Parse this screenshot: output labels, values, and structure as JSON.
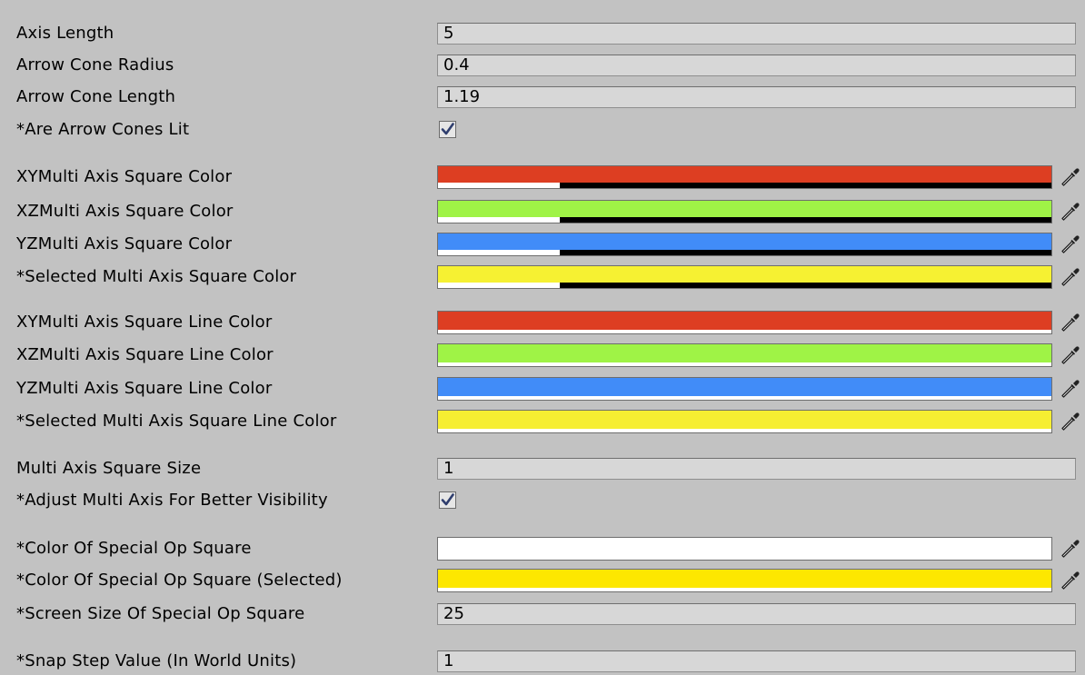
{
  "inspector": {
    "axis_length": {
      "label": "Axis Length",
      "value": "5"
    },
    "arrow_cone_radius": {
      "label": "Arrow Cone Radius",
      "value": "0.4"
    },
    "arrow_cone_length": {
      "label": "Arrow Cone Length",
      "value": "1.19"
    },
    "are_arrow_cones_lit": {
      "label": "*Are Arrow Cones Lit",
      "checked": true
    },
    "xy_square_color": {
      "label": "XYMulti Axis Square Color",
      "color": "#dd3e22"
    },
    "xz_square_color": {
      "label": "XZMulti Axis Square Color",
      "color": "#9ff346"
    },
    "yz_square_color": {
      "label": "YZMulti Axis Square Color",
      "color": "#418cf8"
    },
    "selected_square_color": {
      "label": "*Selected Multi Axis Square Color",
      "color": "#f6f132"
    },
    "xy_line_color": {
      "label": "XYMulti Axis Square Line Color",
      "color": "#dd3e22"
    },
    "xz_line_color": {
      "label": "XZMulti Axis Square Line Color",
      "color": "#9ff346"
    },
    "yz_line_color": {
      "label": "YZMulti Axis Square Line Color",
      "color": "#418cf8"
    },
    "selected_line_color": {
      "label": "*Selected Multi Axis Square Line Color",
      "color": "#f6ee32"
    },
    "multi_axis_square_size": {
      "label": "Multi Axis Square Size",
      "value": "1"
    },
    "adjust_multi_axis": {
      "label": "*Adjust Multi Axis For Better Visibility",
      "checked": true
    },
    "special_op_color": {
      "label": "*Color Of Special Op Square",
      "color": "#ffffff"
    },
    "special_op_selected_color": {
      "label": "*Color Of Special Op Square (Selected)",
      "color": "#fde700"
    },
    "special_op_screen_size": {
      "label": "*Screen Size Of Special Op Square",
      "value": "25"
    },
    "snap_step_value": {
      "label": "*Snap Step Value (In World Units)",
      "value": "1"
    }
  }
}
